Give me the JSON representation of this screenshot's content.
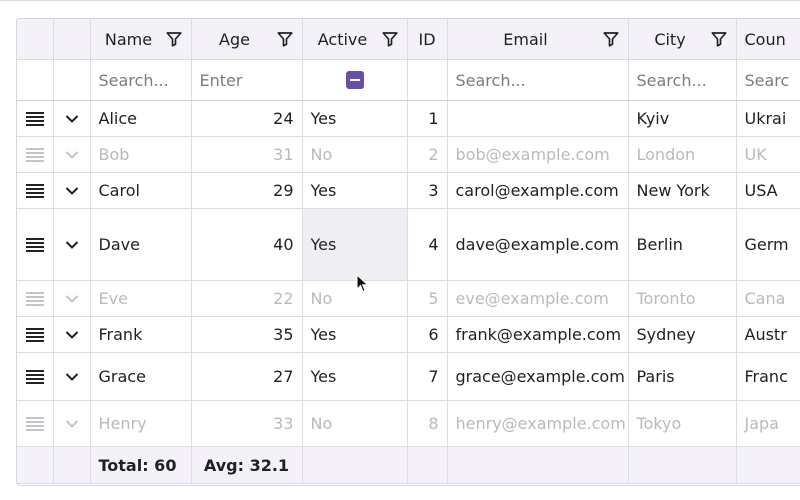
{
  "columns": [
    {
      "key": "handle",
      "label": ""
    },
    {
      "key": "expand",
      "label": ""
    },
    {
      "key": "name",
      "label": "Name",
      "filter": true
    },
    {
      "key": "age",
      "label": "Age",
      "filter": true
    },
    {
      "key": "active",
      "label": "Active",
      "filter": true
    },
    {
      "key": "id",
      "label": "ID",
      "filter": false
    },
    {
      "key": "email",
      "label": "Email",
      "filter": true
    },
    {
      "key": "city",
      "label": "City",
      "filter": true
    },
    {
      "key": "country",
      "label": "Coun",
      "filter": false
    }
  ],
  "filters": {
    "name_placeholder": "Search...",
    "age_placeholder": "Enter",
    "email_placeholder": "Search...",
    "city_placeholder": "Search...",
    "country_placeholder": "Searc"
  },
  "rows": [
    {
      "name": "Alice",
      "age": "24",
      "active": "Yes",
      "id": "1",
      "email": "",
      "city": "Kyiv",
      "country": "Ukrai",
      "dim": false
    },
    {
      "name": "Bob",
      "age": "31",
      "active": "No",
      "id": "2",
      "email": "bob@example.com",
      "city": "London",
      "country": "UK",
      "dim": true
    },
    {
      "name": "Carol",
      "age": "29",
      "active": "Yes",
      "id": "3",
      "email": "carol@example.com",
      "city": "New York",
      "country": "USA",
      "dim": false
    },
    {
      "name": "Dave",
      "age": "40",
      "active": "Yes",
      "id": "4",
      "email": "dave@example.com",
      "city": "Berlin",
      "country": "Germ",
      "dim": false
    },
    {
      "name": "Eve",
      "age": "22",
      "active": "No",
      "id": "5",
      "email": "eve@example.com",
      "city": "Toronto",
      "country": "Cana",
      "dim": true
    },
    {
      "name": "Frank",
      "age": "35",
      "active": "Yes",
      "id": "6",
      "email": "frank@example.com",
      "city": "Sydney",
      "country": "Austr",
      "dim": false
    },
    {
      "name": "Grace",
      "age": "27",
      "active": "Yes",
      "id": "7",
      "email": "grace@example.com",
      "city": "Paris",
      "country": "Franc",
      "dim": false
    },
    {
      "name": "Henry",
      "age": "33",
      "active": "No",
      "id": "8",
      "email": "henry@example.com",
      "city": "Tokyo",
      "country": "Japa",
      "dim": true
    }
  ],
  "footer": {
    "total": "Total: 60",
    "avg": "Avg: 32.1"
  },
  "colors": {
    "accent": "#6750a4",
    "header_bg": "#f4f2f8",
    "border": "#dddbe3"
  },
  "icons": {
    "filter": "filter-icon",
    "drag": "drag-handle-icon",
    "expand": "chevron-down-icon",
    "tristate": "indeterminate-checkbox-icon"
  }
}
